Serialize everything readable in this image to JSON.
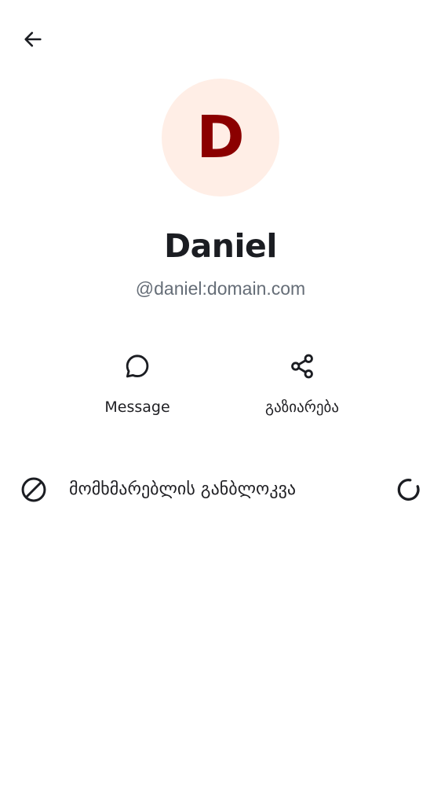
{
  "header": {
    "back_icon": "arrow-left-icon"
  },
  "profile": {
    "avatar_initial": "D",
    "avatar_bg": "#ffeee6",
    "avatar_fg": "#8b0000",
    "display_name": "Daniel",
    "user_id": "@daniel:domain.com",
    "user_id_color": "#656d77"
  },
  "actions": [
    {
      "icon": "message-bubble-icon",
      "label": "Message"
    },
    {
      "icon": "share-icon",
      "label": "გაზიარება"
    }
  ],
  "unblock": {
    "icon": "block-icon",
    "label": "მომხმარებლის განბლოკვა",
    "status_icon": "loading-spinner-icon"
  }
}
